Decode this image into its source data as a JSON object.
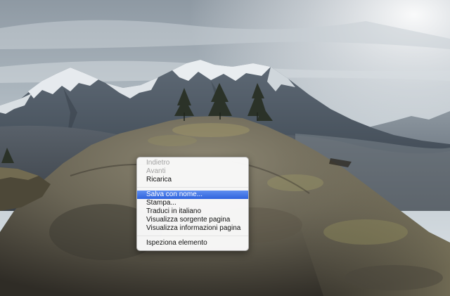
{
  "context_menu": {
    "items": [
      {
        "label": "Indietro",
        "enabled": false
      },
      {
        "label": "Avanti",
        "enabled": false
      },
      {
        "label": "Ricarica",
        "enabled": true
      },
      {
        "label": "Salva con nome...",
        "enabled": true,
        "highlighted": true
      },
      {
        "label": "Stampa...",
        "enabled": true
      },
      {
        "label": "Traduci in italiano",
        "enabled": true
      },
      {
        "label": "Visualizza sorgente pagina",
        "enabled": true
      },
      {
        "label": "Visualizza informazioni pagina",
        "enabled": true
      },
      {
        "label": "Ispeziona elemento",
        "enabled": true
      }
    ]
  },
  "background": {
    "scene": "mountain-landscape-photo",
    "colors": {
      "sky_top": "#9aa6ae",
      "sky_bottom": "#d6dde2",
      "mountain": "#4f5a66",
      "snow": "#e8ecef",
      "rock": "#6e6a5c",
      "moss": "#8a8a55"
    }
  },
  "menu_colors": {
    "highlight": "#3a6ee6",
    "disabled_text": "#a2a2a2"
  }
}
